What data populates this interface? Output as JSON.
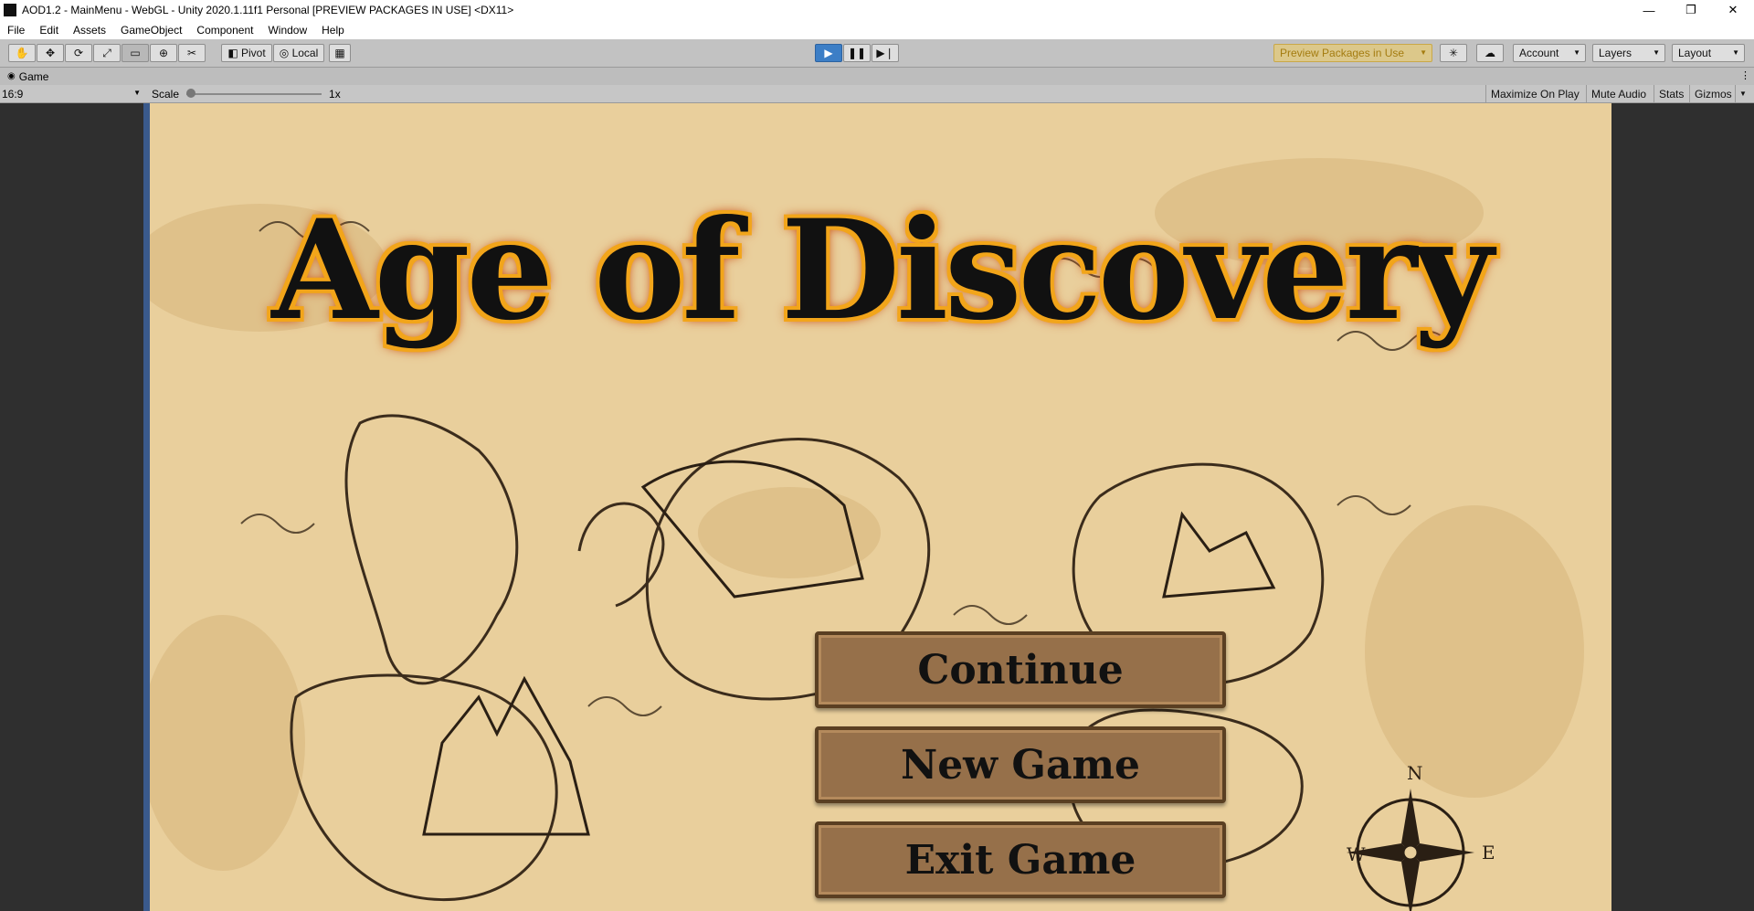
{
  "window": {
    "title": "AOD1.2 - MainMenu - WebGL - Unity 2020.1.11f1 Personal [PREVIEW PACKAGES IN USE] <DX11>",
    "controls": {
      "minimize": "—",
      "restore": "❐",
      "close": "✕"
    }
  },
  "menubar": {
    "items": [
      "File",
      "Edit",
      "Assets",
      "GameObject",
      "Component",
      "Window",
      "Help"
    ]
  },
  "toolbar": {
    "tools": [
      "hand-tool",
      "move-tool",
      "rotate-tool",
      "scale-tool",
      "rect-tool",
      "transform-tool",
      "custom-tool"
    ],
    "pivot_label": "Pivot",
    "local_label": "Local",
    "preview_packages": "Preview Packages in Use",
    "account": "Account",
    "layers": "Layers",
    "layout": "Layout"
  },
  "game_tab": {
    "label": "Game"
  },
  "game_toolbar": {
    "aspect": "16:9",
    "scale_label": "Scale",
    "scale_value": "1x",
    "scale_level": 0,
    "maximize": "Maximize On Play",
    "mute": "Mute Audio",
    "stats": "Stats",
    "gizmos": "Gizmos"
  },
  "game": {
    "title": "Age of Discovery",
    "buttons": [
      "Continue",
      "New Game",
      "Exit Game"
    ],
    "compass": {
      "n": "N",
      "w": "W",
      "e": "E"
    }
  },
  "colors": {
    "parchment": "#e9cf9c",
    "button": "#96704a",
    "title_glow": "#f2a51a",
    "play_active": "#3c7ec6"
  }
}
